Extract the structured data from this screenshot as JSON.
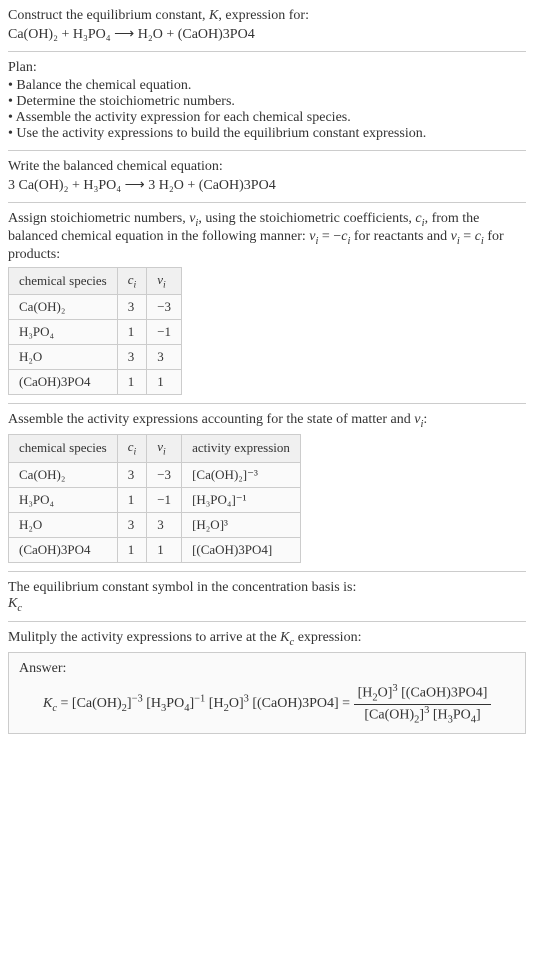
{
  "s1": {
    "intro": "Construct the equilibrium constant, K, expression for:",
    "equation": "Ca(OH)₂ + H₃PO₄ ⟶ H₂O + (CaOH)3PO4"
  },
  "s2": {
    "heading": "Plan:",
    "items": [
      "Balance the chemical equation.",
      "Determine the stoichiometric numbers.",
      "Assemble the activity expression for each chemical species.",
      "Use the activity expressions to build the equilibrium constant expression."
    ]
  },
  "s3": {
    "heading": "Write the balanced chemical equation:",
    "equation": "3 Ca(OH)₂ + H₃PO₄ ⟶ 3 H₂O + (CaOH)3PO4"
  },
  "s4": {
    "text": "Assign stoichiometric numbers, νᵢ, using the stoichiometric coefficients, cᵢ, from the balanced chemical equation in the following manner: νᵢ = −cᵢ for reactants and νᵢ = cᵢ for products:",
    "headers": [
      "chemical species",
      "cᵢ",
      "νᵢ"
    ],
    "rows": [
      [
        "Ca(OH)₂",
        "3",
        "−3"
      ],
      [
        "H₃PO₄",
        "1",
        "−1"
      ],
      [
        "H₂O",
        "3",
        "3"
      ],
      [
        "(CaOH)3PO4",
        "1",
        "1"
      ]
    ]
  },
  "s5": {
    "text": "Assemble the activity expressions accounting for the state of matter and νᵢ:",
    "headers": [
      "chemical species",
      "cᵢ",
      "νᵢ",
      "activity expression"
    ],
    "rows": [
      [
        "Ca(OH)₂",
        "3",
        "−3",
        "[Ca(OH)₂]⁻³"
      ],
      [
        "H₃PO₄",
        "1",
        "−1",
        "[H₃PO₄]⁻¹"
      ],
      [
        "H₂O",
        "3",
        "3",
        "[H₂O]³"
      ],
      [
        "(CaOH)3PO4",
        "1",
        "1",
        "[(CaOH)3PO4]"
      ]
    ]
  },
  "s6": {
    "text": "The equilibrium constant symbol in the concentration basis is:",
    "symbol": "K𝒸"
  },
  "s7": {
    "text": "Mulitply the activity expressions to arrive at the K𝒸 expression:"
  },
  "answer": {
    "label": "Answer:",
    "lhs": "K𝒸 = [Ca(OH)₂]⁻³ [H₃PO₄]⁻¹ [H₂O]³ [(CaOH)3PO4] = ",
    "num": "[H₂O]³ [(CaOH)3PO4]",
    "den": "[Ca(OH)₂]³ [H₃PO₄]"
  },
  "chart_data": {
    "type": "table",
    "tables": [
      {
        "headers": [
          "chemical species",
          "c_i",
          "ν_i"
        ],
        "rows": [
          [
            "Ca(OH)2",
            3,
            -3
          ],
          [
            "H3PO4",
            1,
            -1
          ],
          [
            "H2O",
            3,
            3
          ],
          [
            "(CaOH)3PO4",
            1,
            1
          ]
        ]
      },
      {
        "headers": [
          "chemical species",
          "c_i",
          "ν_i",
          "activity expression"
        ],
        "rows": [
          [
            "Ca(OH)2",
            3,
            -3,
            "[Ca(OH)2]^-3"
          ],
          [
            "H3PO4",
            1,
            -1,
            "[H3PO4]^-1"
          ],
          [
            "H2O",
            3,
            3,
            "[H2O]^3"
          ],
          [
            "(CaOH)3PO4",
            1,
            1,
            "[(CaOH)3PO4]"
          ]
        ]
      }
    ]
  }
}
